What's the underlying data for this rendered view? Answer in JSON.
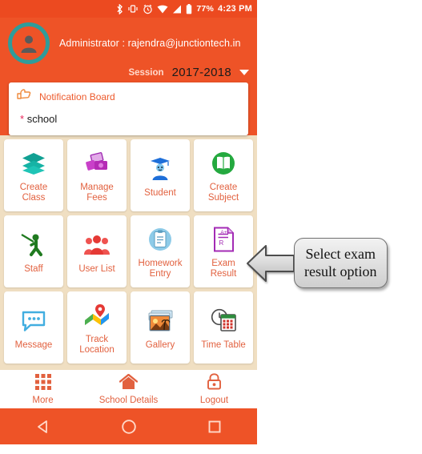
{
  "status_bar": {
    "icons": [
      "bluetooth-icon",
      "vibrate-icon",
      "alarm-icon",
      "wifi-icon",
      "signal-icon",
      "battery-icon"
    ],
    "battery_percent": "77%",
    "time": "4:23 PM"
  },
  "header": {
    "avatar_icon": "user-avatar-icon",
    "admin_text": "Administrator : rajendra@junctiontech.in",
    "session_label": "Session",
    "session_value": "2017-2018",
    "caret_icon": "chevron-down-icon",
    "accent_color": "#ee5327",
    "avatar_ring_color": "#2f9c9a"
  },
  "notification": {
    "icon": "pointing-hand-icon",
    "title": "Notification Board",
    "bullet": "*",
    "item": "school",
    "title_color": "#ed5a2c"
  },
  "grid": {
    "background_color": "#f0dfc2",
    "label_color": "#e2613f",
    "tiles": [
      {
        "label": "Create\nClass",
        "icon": "layers-icon",
        "color": "#11a093"
      },
      {
        "label": "Manage\nFees",
        "icon": "money-icon",
        "color": "#b52bb5"
      },
      {
        "label": "Student",
        "icon": "graduate-icon",
        "color": "#1e6fd9"
      },
      {
        "label": "Create\nSubject",
        "icon": "open-book-icon",
        "color": "#24a93f"
      },
      {
        "label": "Staff",
        "icon": "teacher-pointer-icon",
        "color": "#1f7a1f"
      },
      {
        "label": "User List",
        "icon": "people-group-icon",
        "color": "#ef5350"
      },
      {
        "label": "Homework\nEntry",
        "icon": "clipboard-icon",
        "color": "#63b6dd"
      },
      {
        "label": "Exam\nResult",
        "icon": "exam-document-icon",
        "color": "#a32bb5"
      },
      {
        "label": "Message",
        "icon": "chat-bubble-icon",
        "color": "#42aee0"
      },
      {
        "label": "Track\nLocation",
        "icon": "map-pin-icon",
        "color": "#e53935"
      },
      {
        "label": "Gallery",
        "icon": "photo-stack-icon",
        "color": "#e07b39"
      },
      {
        "label": "Time Table",
        "icon": "clock-calendar-icon",
        "color": "#d0342c"
      }
    ]
  },
  "bottom_nav": [
    {
      "label": "More",
      "icon": "grid-menu-icon"
    },
    {
      "label": "School Details",
      "icon": "home-icon"
    },
    {
      "label": "Logout",
      "icon": "lock-icon"
    }
  ],
  "system_bar": {
    "back_icon": "back-triangle-icon",
    "home_icon": "home-circle-icon",
    "recents_icon": "recents-square-icon"
  },
  "callout": {
    "text": "Select exam\nresult option",
    "arrow_icon": "left-arrow-icon"
  }
}
